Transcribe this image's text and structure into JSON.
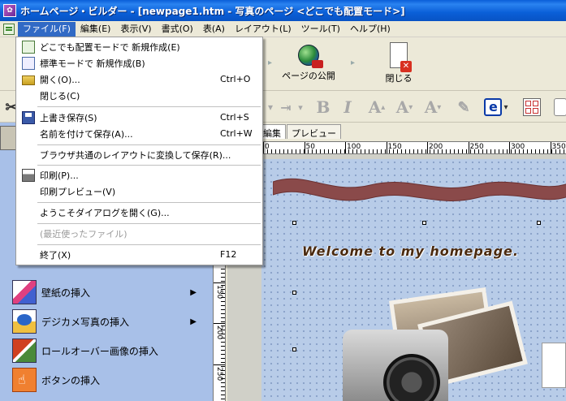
{
  "window": {
    "title": "ホームページ・ビルダー - [newpage1.htm - 写真のページ <どこでも配置モード>]"
  },
  "menubar": {
    "items": [
      {
        "label": "ファイル(F)",
        "active": true
      },
      {
        "label": "編集(E)"
      },
      {
        "label": "表示(V)"
      },
      {
        "label": "書式(O)"
      },
      {
        "label": "表(A)"
      },
      {
        "label": "レイアウト(L)"
      },
      {
        "label": "ツール(T)"
      },
      {
        "label": "ヘルプ(H)"
      }
    ]
  },
  "toolbar": {
    "publish_label": "ページの公開",
    "close_label": "閉じる"
  },
  "tabs": [
    {
      "label": "編集",
      "active": true
    },
    {
      "label": "プレビュー"
    }
  ],
  "ruler": {
    "labels": [
      "0",
      "50",
      "100",
      "150",
      "200",
      "250",
      "300",
      "350"
    ]
  },
  "file_menu": {
    "items": [
      {
        "label": "どこでも配置モードで 新規作成(E)",
        "shortcut": "",
        "icon": "new-page-icon"
      },
      {
        "label": "標準モードで 新規作成(B)",
        "shortcut": "",
        "icon": "standard-page-icon"
      },
      {
        "label": "開く(O)...",
        "shortcut": "Ctrl+O",
        "icon": "open-folder-icon"
      },
      {
        "label": "閉じる(C)",
        "shortcut": "",
        "icon": ""
      },
      {
        "label": "上書き保存(S)",
        "shortcut": "Ctrl+S",
        "icon": "save-icon"
      },
      {
        "label": "名前を付けて保存(A)...",
        "shortcut": "Ctrl+W",
        "icon": ""
      },
      {
        "label": "ブラウザ共通のレイアウトに変換して保存(R)...",
        "shortcut": "",
        "icon": ""
      },
      {
        "label": "印刷(P)...",
        "shortcut": "",
        "icon": "print-icon"
      },
      {
        "label": "印刷プレビュー(V)",
        "shortcut": "",
        "icon": ""
      },
      {
        "label": "ようこそダイアログを開く(G)...",
        "shortcut": "",
        "icon": ""
      },
      {
        "label": "(最近使ったファイル)",
        "shortcut": "",
        "icon": "",
        "disabled": true
      },
      {
        "label": "終了(X)",
        "shortcut": "F12",
        "icon": ""
      }
    ]
  },
  "left_panel": {
    "items": [
      {
        "label": "壁紙の挿入",
        "icon": "wallpaper-icon"
      },
      {
        "label": "デジカメ写真の挿入",
        "icon": "digital-camera-icon"
      },
      {
        "label": "ロールオーバー画像の挿入",
        "icon": "rollover-image-icon"
      },
      {
        "label": "ボタンの挿入",
        "icon": "button-icon"
      }
    ]
  },
  "canvas": {
    "welcome_text": "Welcome to my homepage."
  },
  "colors": {
    "titlebar": "#0a5fd8",
    "menu_highlight": "#316ac5",
    "left_panel": "#a8c0e8",
    "page_bg": "#b8cce8"
  }
}
